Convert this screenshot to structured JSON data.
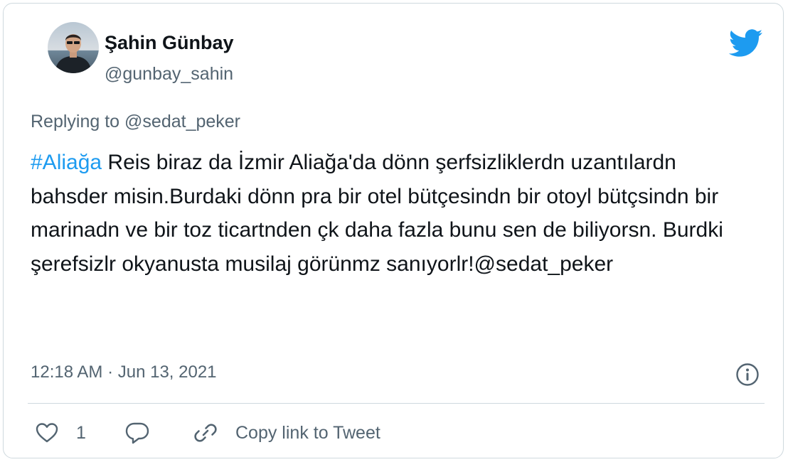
{
  "author": {
    "name": "Şahin Günbay",
    "handle": "@gunbay_sahin",
    "avatar": "profile-photo"
  },
  "reply": {
    "prefix": "Replying to ",
    "mention": "@sedat_peker"
  },
  "tweet": {
    "hashtag": "#Aliağa",
    "body": " Reis biraz da İzmir Aliağa'da dönn şerfsizliklerdn uzantılardn bahsder misin.Burdaki dönn pra bir otel bütçesindn bir otoyl bütçsindn bir marinadn ve bir toz ticartnden çk daha fazla bunu sen de biliyorsn. Burdki şerefsizlr okyanusta musilaj görünmz sanıyorlr!@sedat_peker"
  },
  "timestamp": "12:18 AM · Jun 13, 2021",
  "actions": {
    "like_count": "1",
    "copy_link_label": "Copy link to Tweet"
  },
  "icons": {
    "brand": "twitter-bird-icon",
    "info": "info-icon",
    "like": "heart-icon",
    "reply": "reply-bubble-icon",
    "link": "link-icon"
  },
  "colors": {
    "accent": "#1d9bf0",
    "text": "#0f1419",
    "secondary": "#536471",
    "border": "#cfd9de"
  }
}
